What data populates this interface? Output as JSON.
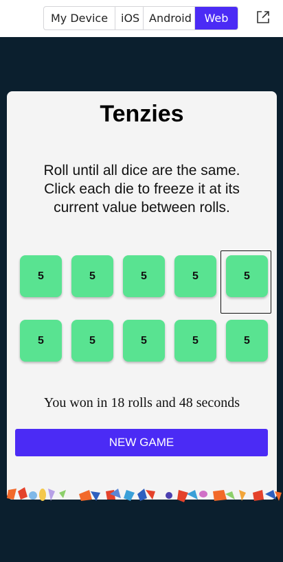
{
  "platform_tabs": [
    {
      "label": "My Device",
      "active": false
    },
    {
      "label": "iOS",
      "active": false
    },
    {
      "label": "Android",
      "active": false
    },
    {
      "label": "Web",
      "active": true
    }
  ],
  "external_link_icon": "external-link-icon",
  "game": {
    "title": "Tenzies",
    "instructions": "Roll until all dice are the same. Click each die to freeze it at its current value between rolls.",
    "dice": [
      "5",
      "5",
      "5",
      "5",
      "5",
      "5",
      "5",
      "5",
      "5",
      "5"
    ],
    "status": "You won in 18 rolls and 48 seconds",
    "new_game_label": "NEW GAME"
  },
  "colors": {
    "accent": "#4b2bf5",
    "die_held": "#59e391",
    "page_bg": "#0b1f2e",
    "card_bg": "#f4f4f4"
  }
}
